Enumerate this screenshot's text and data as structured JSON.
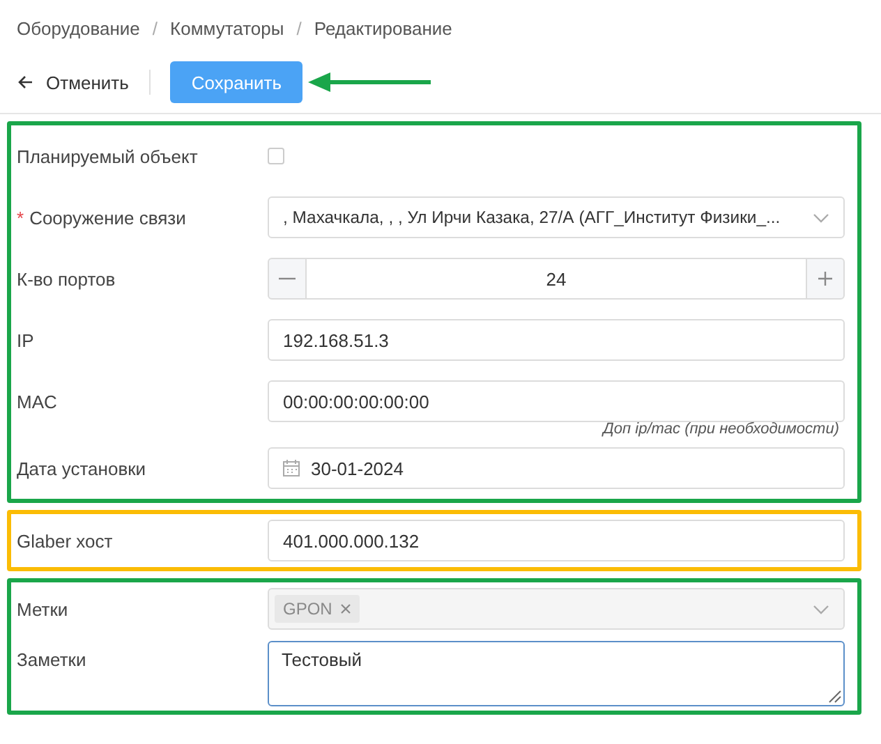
{
  "breadcrumb": [
    {
      "kind": "link",
      "label": "Оборудование"
    },
    {
      "kind": "separator",
      "label": "/"
    },
    {
      "kind": "link",
      "label": "Коммутаторы"
    },
    {
      "kind": "separator",
      "label": "/"
    },
    {
      "kind": "link",
      "label": "Редактирование"
    }
  ],
  "toolbar": {
    "cancel": "Отменить",
    "save": "Сохранить"
  },
  "groups": [
    {
      "color": "#1aa64a",
      "fields": [
        {
          "kind": "checkbox",
          "label": "Планируемый объект",
          "checked": false
        },
        {
          "kind": "select",
          "label": "Сооружение связи",
          "required_mark": "*",
          "value": ", Махачкала, , , Ул Ирчи Казака, 27/А (АГГ_Институт Физики_..."
        },
        {
          "kind": "stepper",
          "label": "К-во портов",
          "value": "24"
        },
        {
          "kind": "text",
          "label": "IP",
          "value": "192.168.51.3"
        },
        {
          "kind": "text",
          "label": "MAC",
          "value": "00:00:00:00:00:00",
          "hint": "Доп ip/mac (при необходимости)"
        },
        {
          "kind": "date",
          "label": "Дата установки",
          "value": "30-01-2024"
        }
      ]
    },
    {
      "color": "#fbbc05",
      "fields": [
        {
          "kind": "text",
          "label": "Glaber хост",
          "value": "401.000.000.132"
        }
      ]
    },
    {
      "color": "#1aa64a",
      "fields": [
        {
          "kind": "tags",
          "label": "Метки",
          "disabled": true,
          "tags": [
            {
              "label": "GPON"
            }
          ]
        },
        {
          "kind": "textarea",
          "label": "Заметки",
          "value": "Тестовый",
          "focused": true
        }
      ]
    }
  ]
}
